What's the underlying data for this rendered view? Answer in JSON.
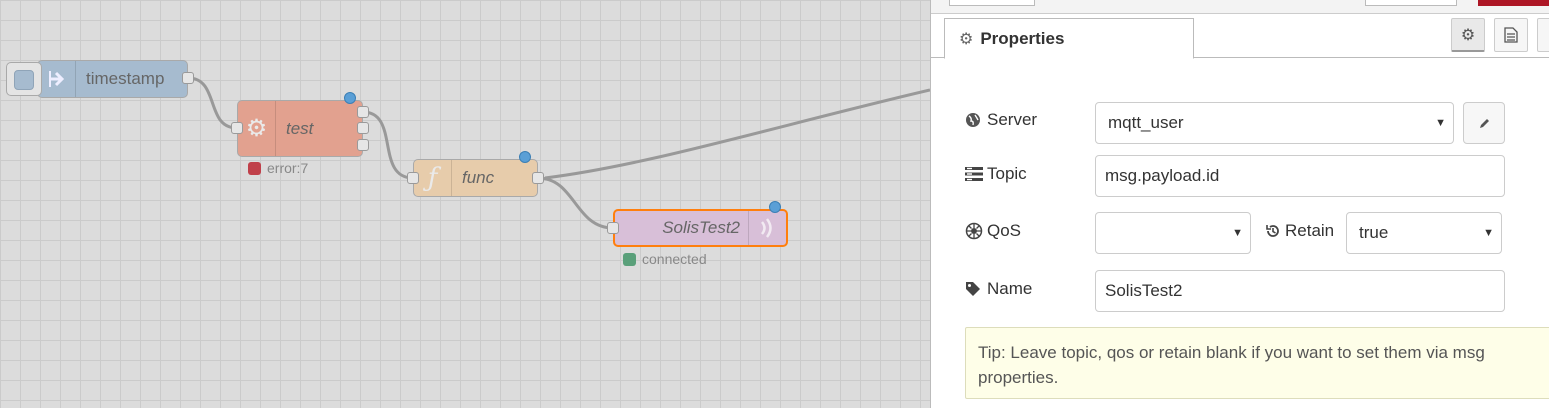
{
  "flow": {
    "nodes": [
      {
        "id": "timestamp",
        "label": "timestamp",
        "color": "#a6bbcf",
        "icon": "inject-arrow-icon"
      },
      {
        "id": "test",
        "label": "test",
        "color": "#e2a18f",
        "icon": "gear-icon",
        "status": "error:7",
        "status_color": "#c0404a"
      },
      {
        "id": "func",
        "label": "func",
        "color": "#e7ccab",
        "icon": "function-icon"
      },
      {
        "id": "solis",
        "label": "SolisTest2",
        "color": "#d8bfd8",
        "icon": "mqtt-out-icon",
        "status": "connected",
        "status_color": "#5aa07a",
        "selected_color": "#ff7f0e"
      }
    ]
  },
  "sidebar": {
    "tab_label": "Properties",
    "tab_icons": [
      "gear-icon",
      "document-icon",
      "book-icon"
    ]
  },
  "form": {
    "server": {
      "label": "Server",
      "value": "mqtt_user"
    },
    "topic": {
      "label": "Topic",
      "value": "msg.payload.id"
    },
    "qos": {
      "label": "QoS",
      "value": ""
    },
    "retain": {
      "label": "Retain",
      "value": "true"
    },
    "name": {
      "label": "Name",
      "value": "SolisTest2"
    },
    "tip": "Tip: Leave topic, qos or retain blank if you want to set them via msg properties."
  }
}
